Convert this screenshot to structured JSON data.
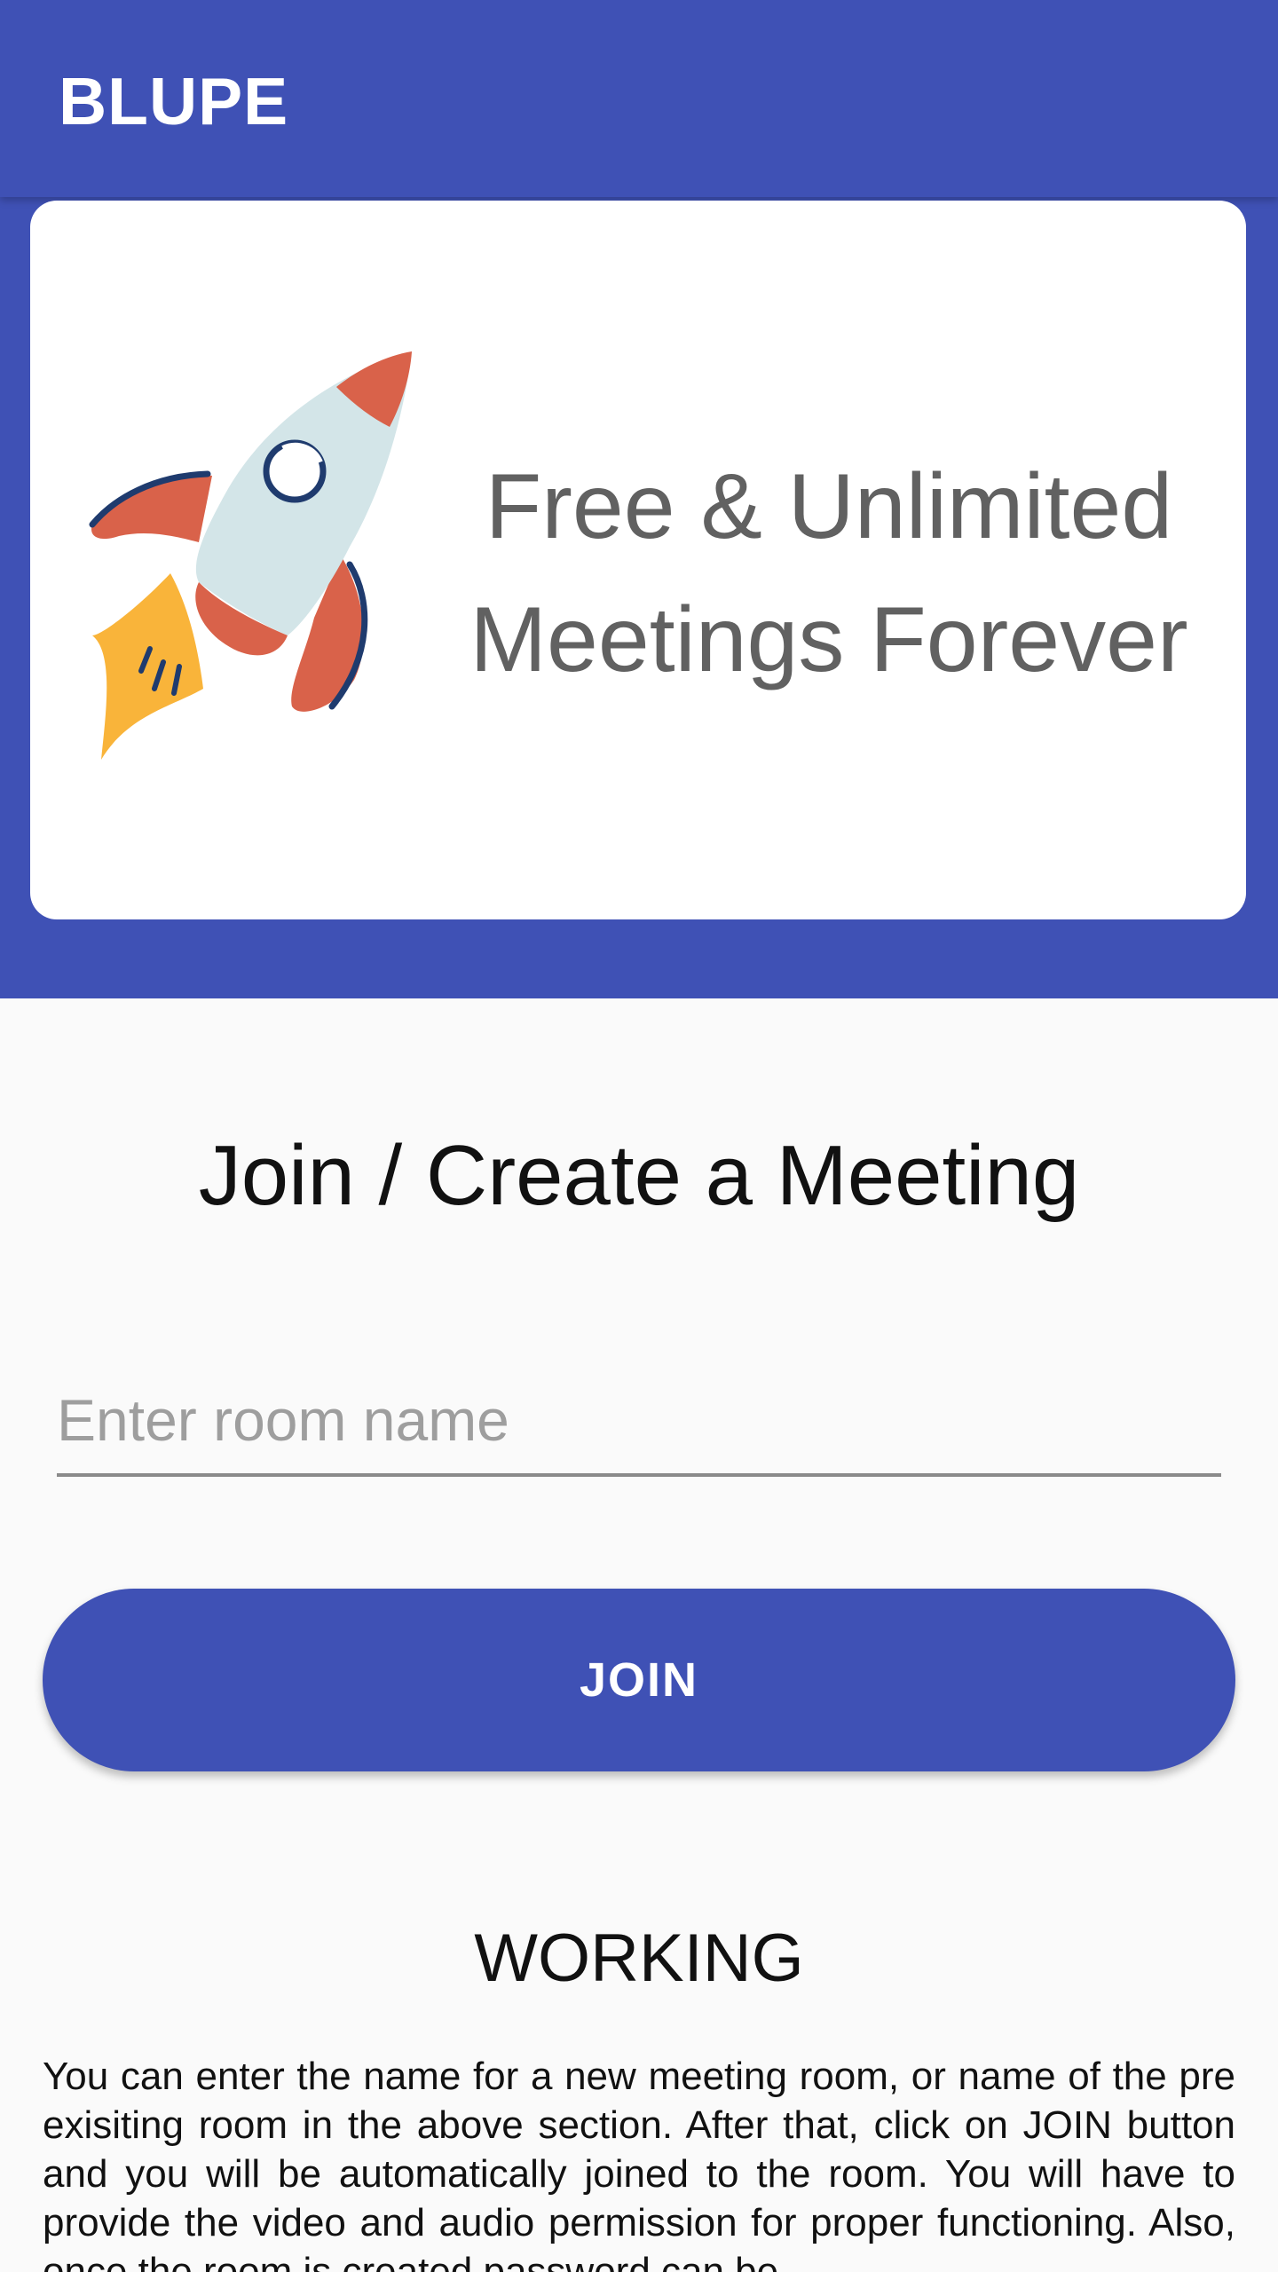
{
  "appbar": {
    "title": "BLUPE"
  },
  "banner": {
    "line1": "Free & Unlimited",
    "line2": "Meetings Forever"
  },
  "main": {
    "title": "Join / Create a Meeting",
    "room_input": {
      "placeholder": "Enter room name",
      "value": ""
    },
    "join_label": "JOIN"
  },
  "working": {
    "title": "WORKING",
    "body": "You can enter the name for a new meeting room, or name of the pre exisiting room in the above section. After that, click on JOIN button and you will be automatically joined to the room. You will have to provide the video and audio permission for proper functioning. Also, once the room is created password can be"
  },
  "colors": {
    "primary": "#3f51b5",
    "rocket_red": "#d9624a",
    "rocket_body": "#d3e5e8",
    "rocket_outline": "#1f3b6e",
    "flame": "#f9b43a"
  },
  "icons": {
    "banner_illustration": "rocket-icon"
  }
}
